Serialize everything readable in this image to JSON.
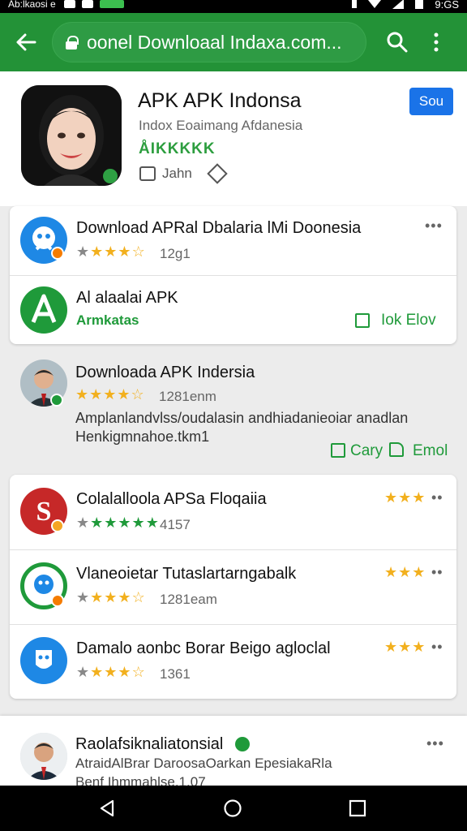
{
  "status_bar": {
    "carrier": "Ab:lkaosi e",
    "time": "9:GS"
  },
  "app_bar": {
    "url": "oonel Downloaal Indaxa.com..."
  },
  "header": {
    "title": "APK APK Indonsa",
    "subtitle": "Indox Eoaimang Afdanesia",
    "rating_text": "ÅIKKKKK",
    "meta_label": "Jahn",
    "button_label": "Sou"
  },
  "card1": {
    "row1": {
      "title": "Download APRal Dbalaria lMi Doonesia",
      "rating_count": "12g1",
      "stars": 4,
      "more_label": "•••"
    },
    "row2": {
      "title": "Al alaalai APK",
      "subtitle": "Armkatas",
      "action_label": "Iok Elov"
    }
  },
  "feature": {
    "title": "Downloada APK Indersia",
    "rating_count": "1281enm",
    "stars": 4,
    "desc_line1": "Amplanlandvlss/oudalasin andhiadanieoiar anadlan",
    "desc_line2": "Henkigmnahoe.tkm1",
    "action1": "Cary",
    "action2": "Emol"
  },
  "card2": {
    "rows": [
      {
        "title": "Colalalloola APSa Floqaiia",
        "rating_count": "4157",
        "stars": 5,
        "right_stars": 3,
        "more_label": "••"
      },
      {
        "title": "Vlaneoietar Tutaslartarngabalk",
        "rating_count": "1281eam",
        "stars": 4,
        "right_stars": 3,
        "more_label": "••"
      },
      {
        "title": "Damalo aonbc Borar Beigo agloclal",
        "rating_count": "1361",
        "stars": 4,
        "right_stars": 3,
        "more_label": "••"
      }
    ]
  },
  "bottom_item": {
    "title": "Raolafsiknaliatonsial",
    "line1": "AtraidAlBrar DaroosaOarkan EpesiakaRla",
    "line2": "Benf Ihmmahlse.1.07",
    "more_label": "•••"
  },
  "colors": {
    "app_bar": "#239237",
    "accent_blue": "#1a73e8",
    "star_gold": "#f2b01e",
    "green": "#1f9a3a"
  },
  "icons": [
    "back-arrow-icon",
    "lock-icon",
    "search-icon",
    "more-vert-icon",
    "calendar-icon",
    "tag-icon",
    "folder-icon",
    "thumbs-up-icon",
    "back-nav-icon",
    "home-nav-icon",
    "recents-nav-icon"
  ]
}
